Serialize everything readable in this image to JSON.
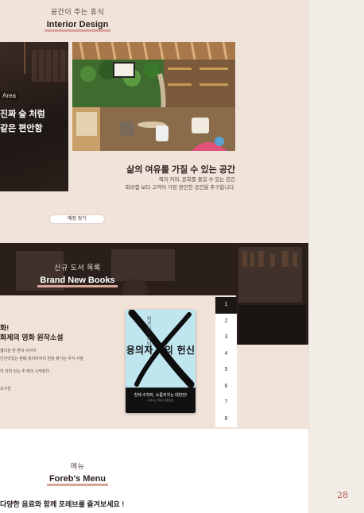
{
  "page_number": "28",
  "interior": {
    "kicker": "공간이 주는 휴식",
    "heading": "Interior Design",
    "area_tag": "Area",
    "card_line1": "진짜 숲 처럼",
    "card_line2": "같은 편안함",
    "title": "삶의 여유를 가질 수 있는 공간",
    "desc_line1": "책과 커피, 문화를 즐길 수 있는 공간",
    "desc_line2": "화려함 보다 고객이 가장 편안한 공간을 추구합니다.",
    "store_button": "매장 찾기"
  },
  "books": {
    "kicker": "신규 도서 목록",
    "heading": "Brand New Books",
    "line1": "화!",
    "line2": "화제의 영화 원작소설",
    "desc1": "웹다운 한 편의 서서서",
    "desc2": "인간이었는 판매 용의자자의 헌을 찾기는 우식 서을",
    "desc3": "의 의미 있는 추 력이 시작된다",
    "desc4": "오가원",
    "cover_title": "용의자 X의 헌신",
    "cover_subtitle": "히가시노 게이고",
    "cover_tagline": "천재 수학자, 소름끼치는 대반전!",
    "cover_small": "히가시노 게이고 장편소설",
    "pages": [
      "1",
      "2",
      "3",
      "4",
      "5",
      "6",
      "7",
      "8"
    ],
    "active_page": "1"
  },
  "menu": {
    "kicker": "메뉴",
    "heading": "Foreb's Menu",
    "text": "다양한 음료와 함께 포레브를 즐겨보세요 !"
  }
}
